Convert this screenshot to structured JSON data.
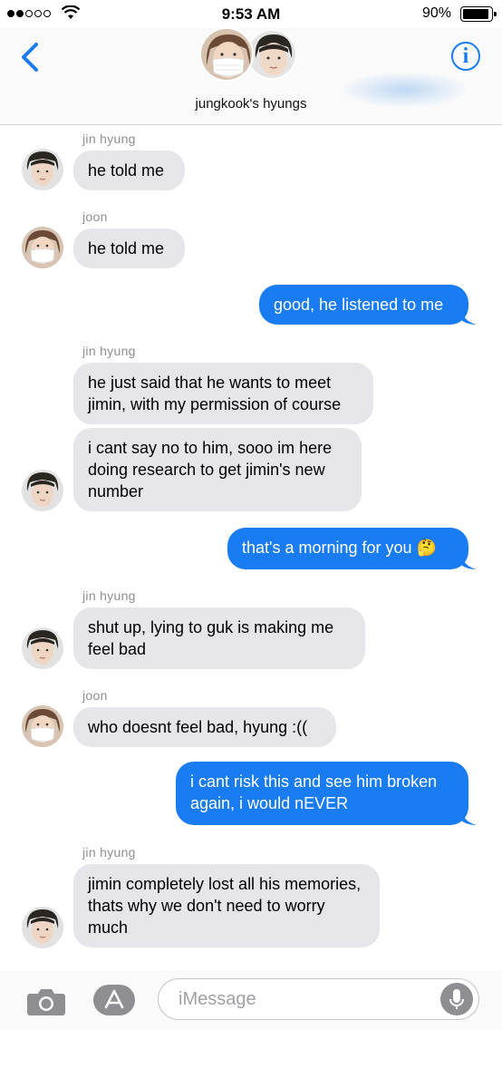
{
  "status_bar": {
    "time": "9:53 AM",
    "battery": "90%"
  },
  "header": {
    "group_name": "jungkook's hyungs",
    "back_icon": "chevron-left-icon",
    "info_icon": "info-icon",
    "info_glyph": "i"
  },
  "messages": [
    {
      "sender": "jin hyung",
      "text": "he told me",
      "from": "received"
    },
    {
      "sender": "joon",
      "text": "he told me",
      "from": "received"
    },
    {
      "text": "good, he listened to me",
      "from": "sent"
    },
    {
      "sender": "jin hyung",
      "text": "he just said that he wants to meet jimin, with my permission of course",
      "from": "received"
    },
    {
      "text": "i cant say no to him, sooo im here doing research to get jimin's new number",
      "from": "received"
    },
    {
      "text": "that's a morning for you 🤔",
      "from": "sent"
    },
    {
      "sender": "jin hyung",
      "text": "shut up, lying to guk is making me feel bad",
      "from": "received"
    },
    {
      "sender": "joon",
      "text": "who doesnt feel bad, hyung :((",
      "from": "received"
    },
    {
      "text": "i cant risk this and see him broken again, i would nEVER",
      "from": "sent"
    },
    {
      "sender": "jin hyung",
      "text": "jimin completely lost all his memories, thats why we don't need to worry much",
      "from": "received"
    }
  ],
  "input_bar": {
    "placeholder": "iMessage",
    "camera_icon": "camera-icon",
    "apps_icon": "app-store-icon",
    "mic_icon": "microphone-icon"
  },
  "colors": {
    "accent": "#1a7cf2",
    "received_bubble": "#e5e5ea",
    "sender_label": "#8e8e93"
  }
}
